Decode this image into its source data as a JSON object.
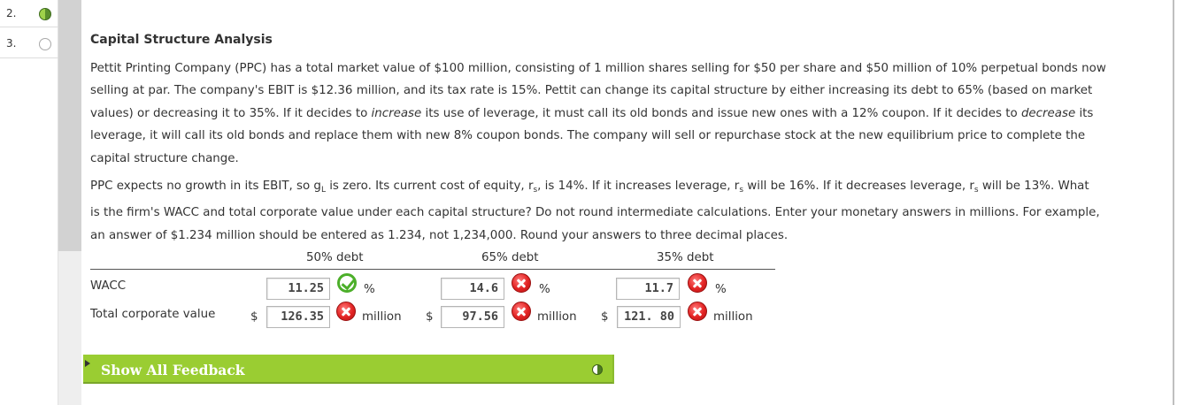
{
  "questions": [
    {
      "number": "2.",
      "status": "answered"
    },
    {
      "number": "3.",
      "status": "unanswered"
    }
  ],
  "problem": {
    "title": "Capital Structure Analysis",
    "p1": [
      "Pettit Printing Company (PPC) has a total market value of $100 million, consisting of 1 million shares selling for $50 per share and $50 million of 10% perpetual bonds now",
      "selling at par. The company's EBIT is $12.36 million, and its tax rate is 15%. Pettit can change its capital structure by either increasing its debt to 65% (based on market",
      "values) or decreasing it to 35%. If it decides to ",
      "increase",
      " its use of leverage, it must call its old bonds and issue new ones with a 12% coupon. If it decides to ",
      "decrease",
      " its",
      "leverage, it will call its old bonds and replace them with new 8% coupon bonds. The company will sell or repurchase stock at the new equilibrium price to complete the",
      "capital structure change."
    ],
    "p2": [
      "PPC expects no growth in its EBIT, so g",
      "L",
      " is zero. Its current cost of equity, r",
      "s",
      ", is 14%. If it increases leverage, r",
      "s",
      " will be 16%. If it decreases leverage, r",
      "s",
      " will be 13%. What",
      "is the firm's WACC and total corporate value under each capital structure? Do not round intermediate calculations. Enter your monetary answers in millions. For example,",
      "an answer of $1.234 million should be entered as 1.234, not 1,234,000. Round your answers to three decimal places."
    ]
  },
  "table": {
    "columns": [
      "50% debt",
      "65% debt",
      "35% debt"
    ],
    "rows": [
      {
        "label": "WACC",
        "currency": "",
        "unit": "%",
        "cells": [
          {
            "value": "11.25",
            "result": "correct"
          },
          {
            "value": "14.6",
            "result": "incorrect"
          },
          {
            "value": "11.7",
            "result": "incorrect"
          }
        ]
      },
      {
        "label": "Total corporate value",
        "currency": "$",
        "unit": "million",
        "cells": [
          {
            "value": "126.35",
            "result": "incorrect"
          },
          {
            "value": "97.56",
            "result": "incorrect"
          },
          {
            "value": "121. 80",
            "result": "incorrect"
          }
        ]
      }
    ]
  },
  "feedback": {
    "label": "Show All Feedback"
  },
  "colors": {
    "correct": "#4caf2a",
    "incorrect": "#e32323",
    "feedback_bar": "#9acd32"
  }
}
